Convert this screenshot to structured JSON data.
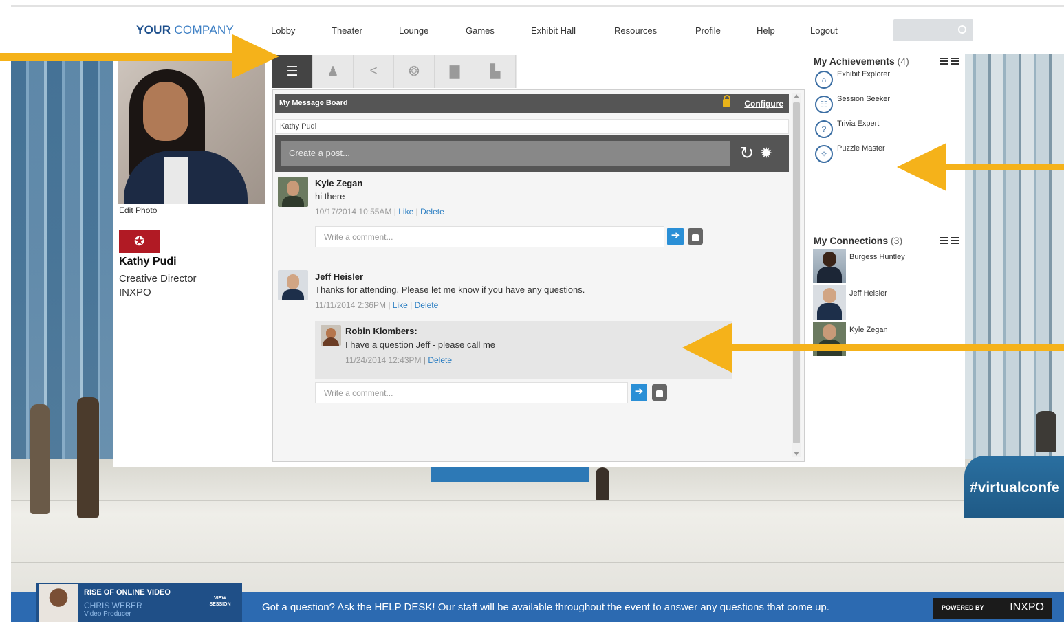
{
  "brand": {
    "logo_bold": "YOUR",
    "logo_light": "COMPANY"
  },
  "nav": [
    "Lobby",
    "Theater",
    "Lounge",
    "Games",
    "Exhibit Hall",
    "Resources",
    "Profile",
    "Help",
    "Logout"
  ],
  "profile": {
    "edit_photo": "Edit Photo",
    "name": "Kathy Pudi",
    "title": "Creative Director",
    "org": "INXPO"
  },
  "tabs": [
    "list-icon",
    "user-icon",
    "share-icon",
    "chat-icon",
    "briefcase-icon",
    "chart-icon"
  ],
  "board": {
    "title": "My Message Board",
    "configure": "Configure",
    "owner": "Kathy Pudi",
    "post_placeholder": "Create a post...",
    "comment_placeholder": "Write a comment...",
    "posts": [
      {
        "author": "Kyle Zegan",
        "text": "hi there",
        "time": "10/17/2014 10:55AM",
        "like": "Like",
        "delete": "Delete"
      },
      {
        "author": "Jeff Heisler",
        "text": "Thanks for attending. Please let me know if you have any questions.",
        "time": "11/11/2014 2:36PM",
        "like": "Like",
        "delete": "Delete"
      }
    ],
    "reply": {
      "author": "Robin Klombers:",
      "text": "I have a question Jeff - please call me",
      "time": "11/24/2014 12:43PM",
      "delete": "Delete"
    },
    "separator": "|"
  },
  "achievements": {
    "title": "My Achievements",
    "count": "(4)",
    "items": [
      "Exhibit Explorer",
      "Session Seeker",
      "Trivia Expert",
      "Puzzle Master"
    ]
  },
  "connections": {
    "title": "My Connections",
    "count": "(3)",
    "items": [
      "Burgess Huntley",
      "Jeff Heisler",
      "Kyle Zegan"
    ]
  },
  "scene": {
    "hashtag": "#virtualconfe"
  },
  "footer": {
    "promo_title": "RISE OF ONLINE VIDEO",
    "promo_name": "CHRIS WEBER",
    "promo_role": "Video Producer",
    "promo_button": "VIEW SESSION",
    "helpdesk": "Got a question? Ask the HELP DESK! Our staff will be available throughout the event to answer any questions that come up.",
    "powered_by": "POWERED BY",
    "powered_brand": "INXPO"
  },
  "colors": {
    "arrow": "#f5b21a",
    "brand_blue": "#1d4f8c",
    "badge_red": "#b11a24",
    "link_blue": "#2b7ec2",
    "footer_blue": "#2c6ab1"
  }
}
